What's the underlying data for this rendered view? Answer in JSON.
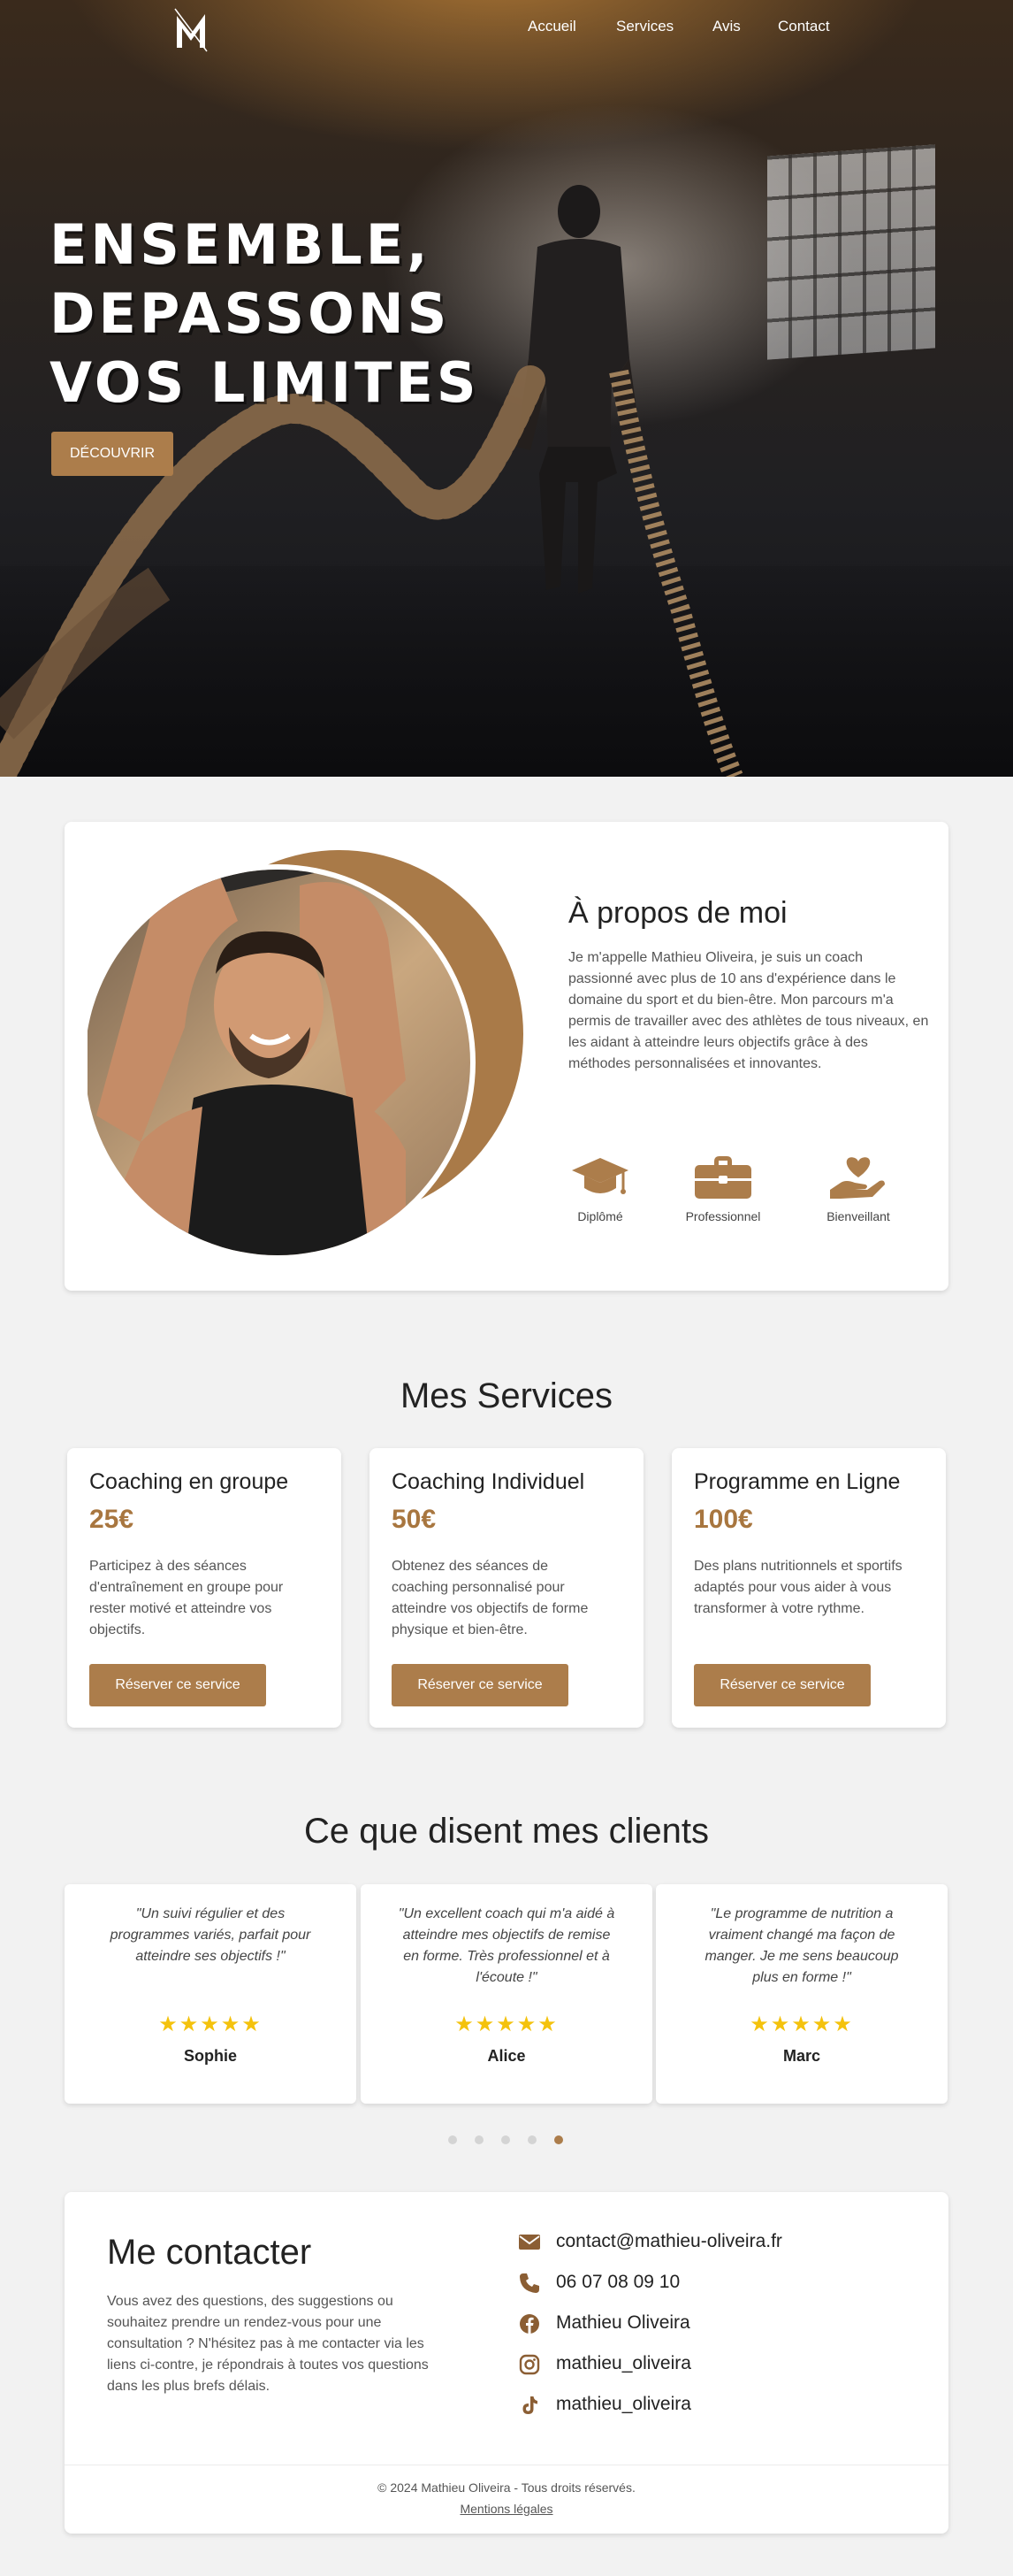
{
  "colors": {
    "accent": "#ac7d4b",
    "price": "#a8763f",
    "star": "#f4c20d",
    "background": "#f2f2f2"
  },
  "nav": {
    "items": [
      "Accueil",
      "Services",
      "Avis",
      "Contact"
    ]
  },
  "hero": {
    "title_lines": [
      "ENSEMBLE,",
      "DEPASSONS",
      "VOS LIMITES"
    ],
    "cta_label": "DÉCOUVRIR"
  },
  "about": {
    "title": "À propos de moi",
    "text": "Je m'appelle Mathieu Oliveira, je suis un coach passionné avec plus de 10 ans d'expérience dans le domaine du sport et du bien-être. Mon parcours m'a permis de travailler avec des athlètes de tous niveaux, en les aidant à atteindre leurs objectifs grâce à des méthodes personnalisées et innovantes.",
    "features": [
      {
        "icon": "graduation-cap-icon",
        "label": "Diplômé"
      },
      {
        "icon": "briefcase-icon",
        "label": "Professionnel"
      },
      {
        "icon": "hand-heart-icon",
        "label": "Bienveillant"
      }
    ]
  },
  "services": {
    "title": "Mes Services",
    "items": [
      {
        "name": "Coaching en groupe",
        "price": "25€",
        "description": "Participez à des séances d'entraînement en groupe pour rester motivé et atteindre vos objectifs.",
        "button": "Réserver ce service"
      },
      {
        "name": "Coaching Individuel",
        "price": "50€",
        "description": "Obtenez des séances de coaching personnalisé pour atteindre vos objectifs de forme physique et bien-être.",
        "button": "Réserver ce service"
      },
      {
        "name": "Programme en Ligne",
        "price": "100€",
        "description": "Des plans nutritionnels et sportifs adaptés pour vous aider à vous transformer à votre rythme.",
        "button": "Réserver ce service"
      }
    ]
  },
  "testimonials": {
    "title": "Ce que disent mes clients",
    "items": [
      {
        "quote": "\"Un suivi régulier et des programmes variés, parfait pour atteindre ses objectifs !\"",
        "stars": "★★★★★",
        "rating": 5,
        "name": "Sophie"
      },
      {
        "quote": "\"Un excellent coach qui m'a aidé à atteindre mes objectifs de remise en forme. Très professionnel et à l'écoute !\"",
        "stars": "★★★★★",
        "rating": 5,
        "name": "Alice"
      },
      {
        "quote": "\"Le programme de nutrition a vraiment changé ma façon de manger. Je me sens beaucoup plus en forme !\"",
        "stars": "★★★★★",
        "rating": 5,
        "name": "Marc"
      }
    ],
    "pagination": {
      "count": 5,
      "active_index": 4
    }
  },
  "contact": {
    "title": "Me contacter",
    "text": "Vous avez des questions, des suggestions ou souhaitez prendre un rendez-vous pour une consultation ? N'hésitez pas à me contacter via les liens ci-contre, je répondrais à toutes vos questions dans les plus brefs délais.",
    "items": [
      {
        "icon": "envelope-icon",
        "value": "contact@mathieu-oliveira.fr"
      },
      {
        "icon": "phone-icon",
        "value": "06 07 08 09 10"
      },
      {
        "icon": "facebook-icon",
        "value": "Mathieu Oliveira"
      },
      {
        "icon": "instagram-icon",
        "value": "mathieu_oliveira"
      },
      {
        "icon": "tiktok-icon",
        "value": "mathieu_oliveira"
      }
    ]
  },
  "footer": {
    "copyright": "© 2024 Mathieu Oliveira - Tous droits réservés.",
    "legal_link": "Mentions légales"
  }
}
